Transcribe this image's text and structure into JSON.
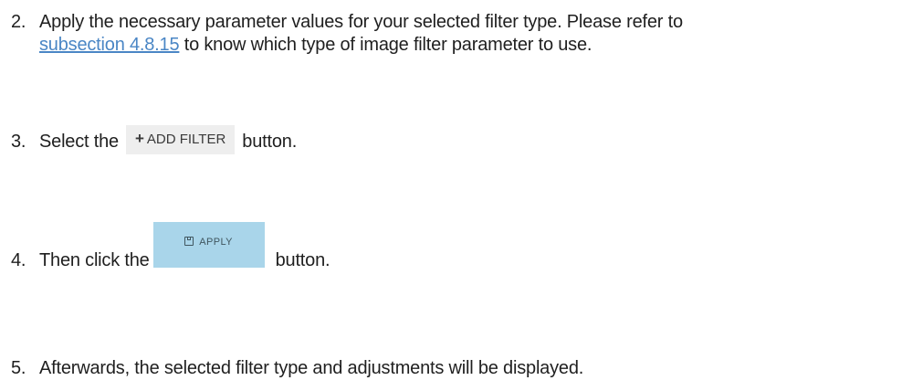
{
  "steps": [
    {
      "number": "2.",
      "line1": "Apply the necessary parameter values for your selected filter type. Please refer to",
      "link_text": "subsection 4.8.15",
      "line2_rest": " to know which type of image filter parameter to use."
    },
    {
      "number": "3.",
      "before": "Select the",
      "button_icon": "plus-icon",
      "button_label": "ADD FILTER",
      "after": "button."
    },
    {
      "number": "4.",
      "before": "Then click the",
      "button_icon": "save-icon",
      "button_label": "APPLY",
      "after": "button."
    },
    {
      "number": "5.",
      "text": "Afterwards, the selected filter type and adjustments will be displayed."
    }
  ],
  "colors": {
    "text": "#1f1f1f",
    "link": "#4a86c5",
    "add_filter_bg": "#eeeeee",
    "apply_bg": "#a9d5ea"
  }
}
